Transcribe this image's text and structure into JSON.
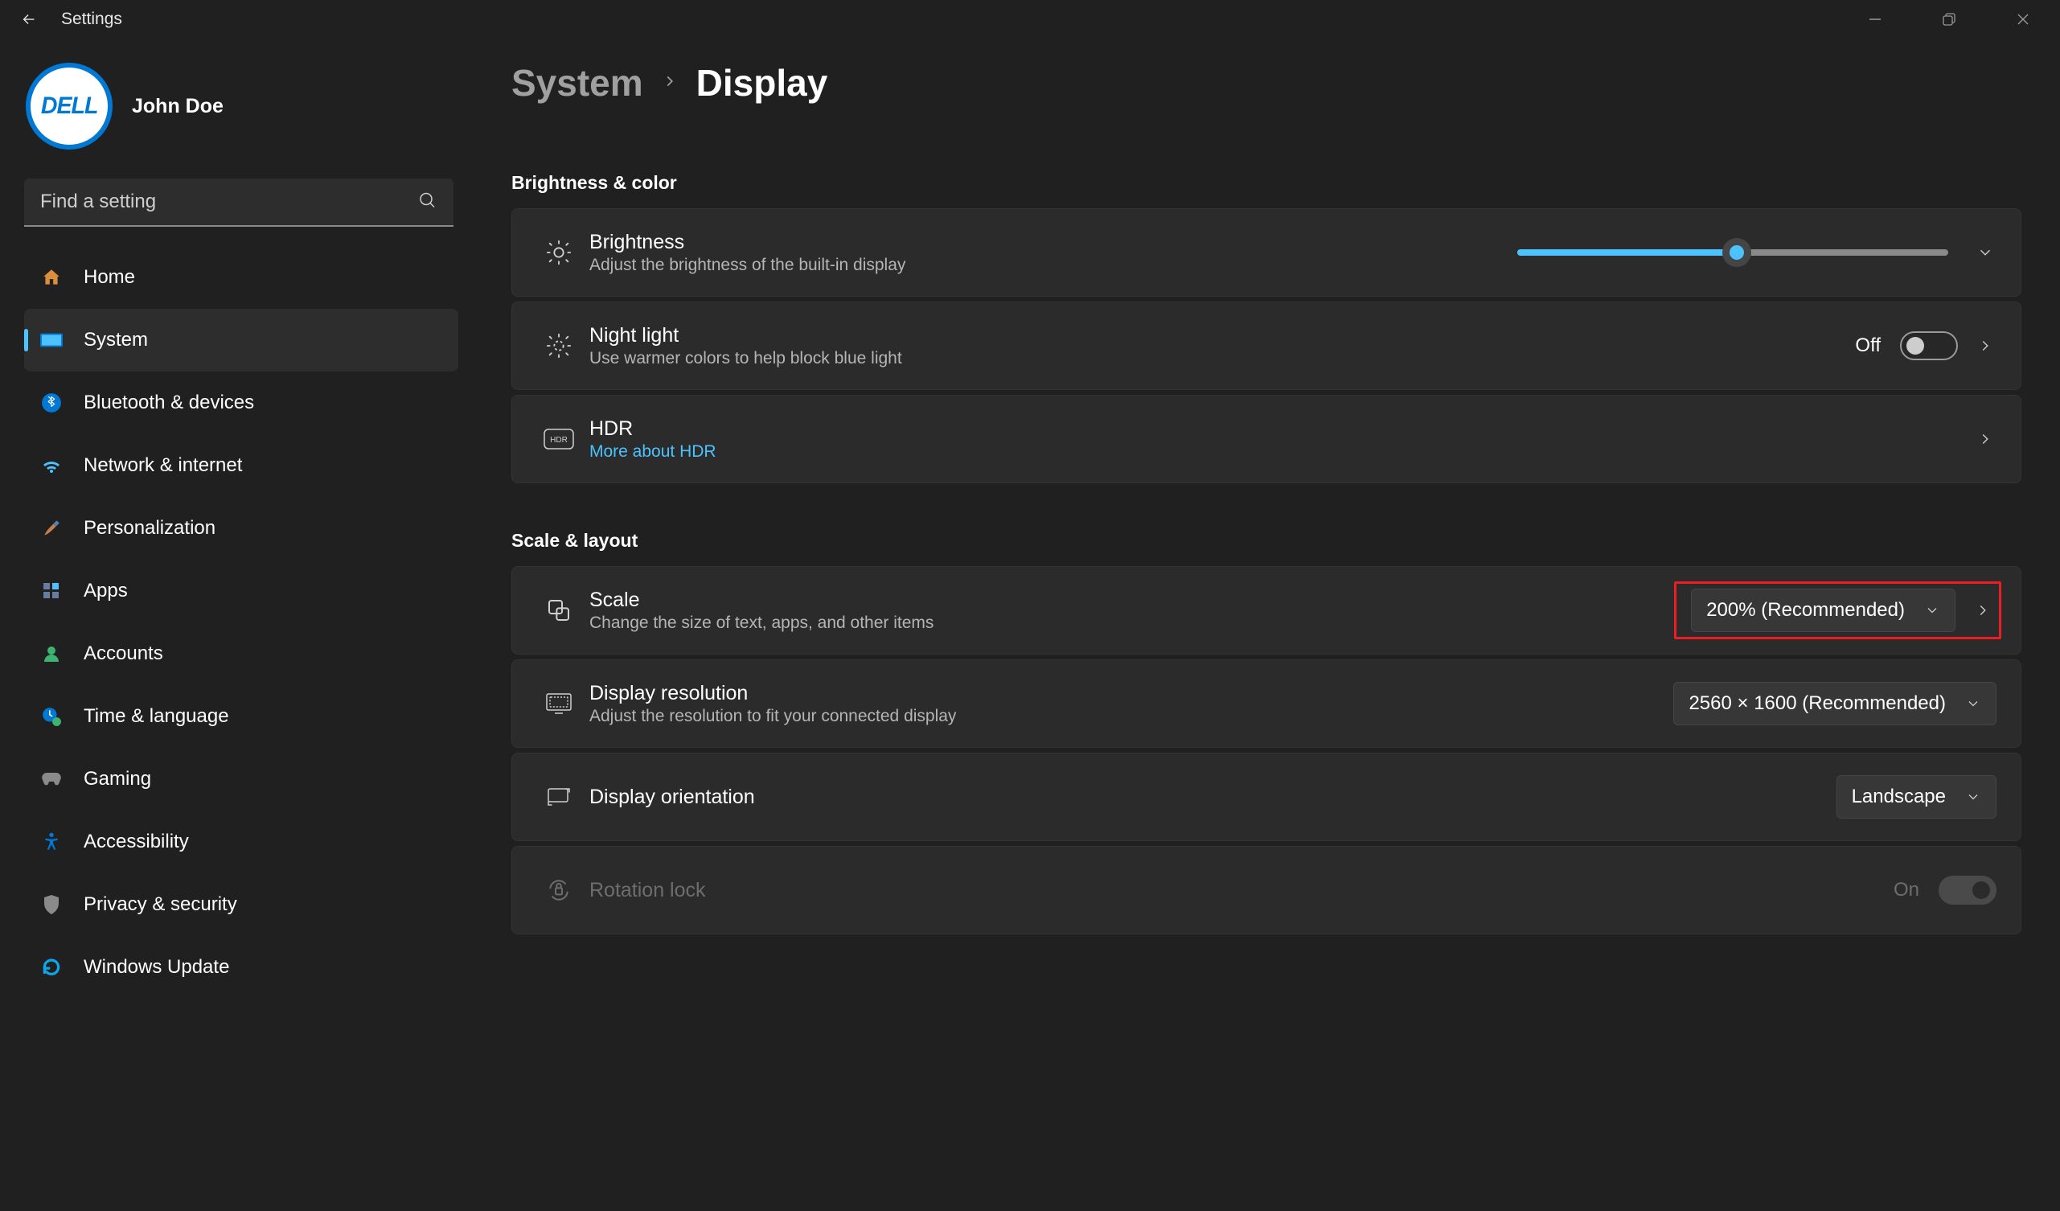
{
  "titlebar": {
    "app": "Settings"
  },
  "profile": {
    "brand": "DELL",
    "name": "John Doe"
  },
  "search": {
    "placeholder": "Find a setting"
  },
  "nav": [
    {
      "label": "Home"
    },
    {
      "label": "System"
    },
    {
      "label": "Bluetooth & devices"
    },
    {
      "label": "Network & internet"
    },
    {
      "label": "Personalization"
    },
    {
      "label": "Apps"
    },
    {
      "label": "Accounts"
    },
    {
      "label": "Time & language"
    },
    {
      "label": "Gaming"
    },
    {
      "label": "Accessibility"
    },
    {
      "label": "Privacy & security"
    },
    {
      "label": "Windows Update"
    }
  ],
  "breadcrumb": {
    "parent": "System",
    "current": "Display"
  },
  "sections": {
    "brightness_color": {
      "title": "Brightness & color",
      "brightness": {
        "title": "Brightness",
        "sub": "Adjust the brightness of the built-in display",
        "value_percent": 51
      },
      "night_light": {
        "title": "Night light",
        "sub": "Use warmer colors to help block blue light",
        "state_label": "Off",
        "on": false
      },
      "hdr": {
        "title": "HDR",
        "link": "More about HDR"
      }
    },
    "scale_layout": {
      "title": "Scale & layout",
      "scale": {
        "title": "Scale",
        "sub": "Change the size of text, apps, and other items",
        "value": "200% (Recommended)"
      },
      "resolution": {
        "title": "Display resolution",
        "sub": "Adjust the resolution to fit your connected display",
        "value": "2560 × 1600 (Recommended)"
      },
      "orientation": {
        "title": "Display orientation",
        "value": "Landscape"
      },
      "rotation_lock": {
        "title": "Rotation lock",
        "state_label": "On",
        "on": true
      }
    }
  }
}
